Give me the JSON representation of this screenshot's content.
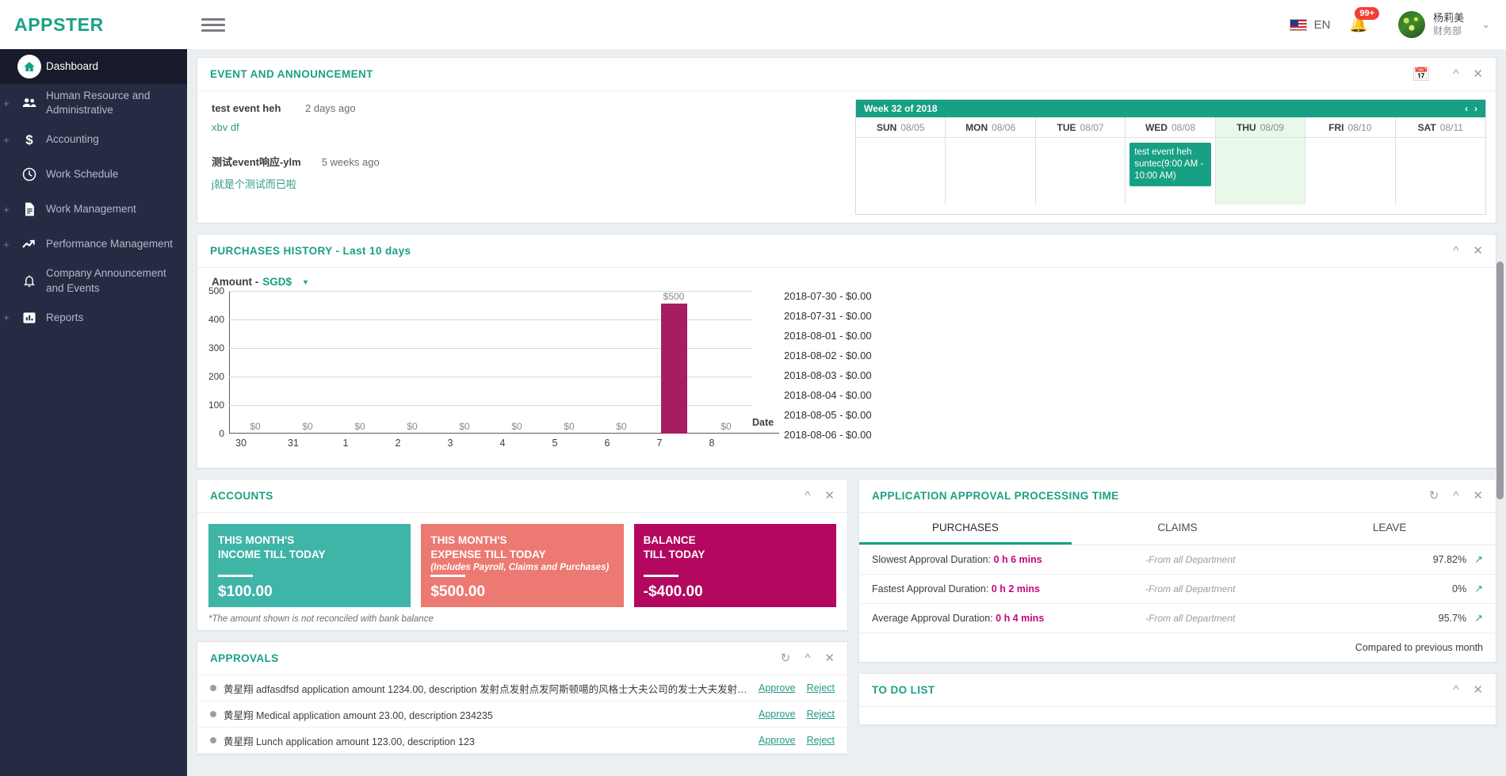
{
  "header": {
    "brand": "APPSTER",
    "menu_icon": "hamburger-icon",
    "language": "EN",
    "flag": "us-flag-icon",
    "notification_badge": "99+",
    "user_name": "杨莉美",
    "user_dept": "财务部",
    "caret": "⌄"
  },
  "sidebar": {
    "items": [
      {
        "label": "Dashboard",
        "icon": "home-icon",
        "expandable": false,
        "active": true
      },
      {
        "label": "Human Resource and Administrative",
        "icon": "people-icon",
        "expandable": true,
        "active": false
      },
      {
        "label": "Accounting",
        "icon": "dollar-icon",
        "expandable": true,
        "active": false
      },
      {
        "label": "Work Schedule",
        "icon": "clock-icon",
        "expandable": false,
        "active": false
      },
      {
        "label": "Work Management",
        "icon": "document-icon",
        "expandable": true,
        "active": false
      },
      {
        "label": "Performance Management",
        "icon": "trend-up-icon",
        "expandable": true,
        "active": false
      },
      {
        "label": "Company Announcement and Events",
        "icon": "bell-icon",
        "expandable": false,
        "active": false
      },
      {
        "label": "Reports",
        "icon": "bar-chart-icon",
        "expandable": true,
        "active": false
      }
    ]
  },
  "event_panel": {
    "title": "EVENT AND ANNOUNCEMENT",
    "tools": [
      "calendar-icon",
      "collapse-icon",
      "close-icon"
    ],
    "events": [
      {
        "title": "test event heh",
        "time": "2 days ago",
        "desc": "xbv df"
      },
      {
        "title": "测试event响应-ylm",
        "time": "5 weeks ago",
        "desc": "j就是个测试而已啦"
      }
    ],
    "calendar": {
      "week_label": "Week 32 of 2018",
      "prev": "‹",
      "next": "›",
      "days": [
        {
          "dow": "SUN",
          "date": "08/05",
          "today": false,
          "event": null
        },
        {
          "dow": "MON",
          "date": "08/06",
          "today": false,
          "event": null
        },
        {
          "dow": "TUE",
          "date": "08/07",
          "today": false,
          "event": null
        },
        {
          "dow": "WED",
          "date": "08/08",
          "today": false,
          "event": "test event heh suntec(9:00 AM - 10:00 AM)"
        },
        {
          "dow": "THU",
          "date": "08/09",
          "today": true,
          "event": null
        },
        {
          "dow": "FRI",
          "date": "08/10",
          "today": false,
          "event": null
        },
        {
          "dow": "SAT",
          "date": "08/11",
          "today": false,
          "event": null
        }
      ]
    }
  },
  "purchases_panel": {
    "title": "PURCHASES HISTORY",
    "subtitle": " - Last 10 days",
    "tools": [
      "collapse-icon",
      "close-icon"
    ],
    "amount_label": "Amount -",
    "currency": "SGD$",
    "list": [
      "2018-07-30 - $0.00",
      "2018-07-31 - $0.00",
      "2018-08-01 - $0.00",
      "2018-08-02 - $0.00",
      "2018-08-03 - $0.00",
      "2018-08-04 - $0.00",
      "2018-08-05 - $0.00",
      "2018-08-06 - $0.00"
    ]
  },
  "chart_data": {
    "type": "bar",
    "title": "PURCHASES HISTORY - Last 10 days",
    "xlabel": "Date",
    "ylabel": "Amount - SGD$",
    "categories": [
      "30",
      "31",
      "1",
      "2",
      "3",
      "4",
      "5",
      "6",
      "7",
      "8"
    ],
    "values": [
      0,
      0,
      0,
      0,
      0,
      0,
      0,
      0,
      500,
      0
    ],
    "point_labels": [
      "$0",
      "$0",
      "$0",
      "$0",
      "$0",
      "$0",
      "$0",
      "$0",
      "$500",
      "$0"
    ],
    "yticks": [
      0,
      100,
      200,
      300,
      400,
      500
    ],
    "ylim": [
      0,
      500
    ],
    "grid": true,
    "legend": "none",
    "bar_color": "#a61d62"
  },
  "accounts_panel": {
    "title": "ACCOUNTS",
    "tools": [
      "collapse-icon",
      "close-icon"
    ],
    "cards": [
      {
        "title": "THIS MONTH'S\nINCOME TILL TODAY",
        "line1": "THIS MONTH'S",
        "line2": "INCOME TILL TODAY",
        "note": "",
        "value": "$100.00",
        "color": "#3fb5a8"
      },
      {
        "title": "THIS MONTH'S EXPENSE TILL TODAY",
        "line1": "THIS MONTH'S",
        "line2": "EXPENSE TILL TODAY",
        "note": "(Includes Payroll, Claims and Purchases)",
        "value": "$500.00",
        "color": "#ec7a72"
      },
      {
        "title": "BALANCE TILL TODAY",
        "line1": "BALANCE",
        "line2": "TILL TODAY",
        "note": "",
        "value": "-$400.00",
        "color": "#b4075f"
      }
    ],
    "footnote": "*The amount shown is not reconciled with bank balance"
  },
  "approvals_panel": {
    "title": "APPROVALS",
    "tools": [
      "refresh-icon",
      "collapse-icon",
      "close-icon"
    ],
    "rows": [
      {
        "text": "黄星翔 adfasdfsd application amount 1234.00, description 发射点发射点发阿斯顿噶的风格士大夫公司的发士大夫发射点发射点...",
        "approve": "Approve",
        "reject": "Reject"
      },
      {
        "text": "黄星翔 Medical application amount 23.00, description 234235",
        "approve": "Approve",
        "reject": "Reject"
      },
      {
        "text": "黄星翔 Lunch application amount 123.00, description 123",
        "approve": "Approve",
        "reject": "Reject"
      }
    ]
  },
  "approval_time_panel": {
    "title": "APPLICATION APPROVAL PROCESSING TIME",
    "tools": [
      "refresh-icon",
      "collapse-icon",
      "close-icon"
    ],
    "tabs": [
      {
        "label": "PURCHASES",
        "active": true
      },
      {
        "label": "CLAIMS",
        "active": false
      },
      {
        "label": "LEAVE",
        "active": false
      }
    ],
    "rows": [
      {
        "label": "Slowest Approval Duration:",
        "value": "0 h 6 mins",
        "dept": "-From all Department",
        "pct": "97.82%",
        "arrow": "trend-up-icon"
      },
      {
        "label": "Fastest Approval Duration:",
        "value": "0 h 2 mins",
        "dept": "-From all Department",
        "pct": "0%",
        "arrow": "trend-up-icon"
      },
      {
        "label": "Average Approval Duration:",
        "value": "0 h 4 mins",
        "dept": "-From all Department",
        "pct": "95.7%",
        "arrow": "trend-up-icon"
      }
    ],
    "footer": "Compared to previous month"
  },
  "todo_panel": {
    "title": "TO DO LIST",
    "tools": [
      "collapse-icon",
      "close-icon"
    ]
  }
}
